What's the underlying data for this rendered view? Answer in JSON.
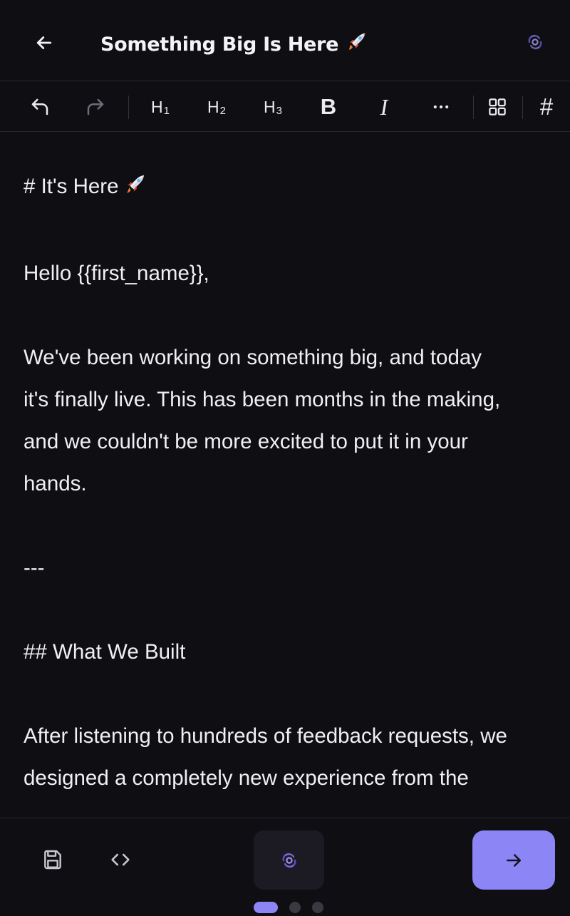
{
  "header": {
    "title": "Something Big Is Here",
    "back_icon": "arrow-left-icon",
    "logo_icon": "swirl-logo-icon"
  },
  "toolbar": {
    "undo_icon": "undo-icon",
    "redo_icon": "redo-icon",
    "h1_label": "H",
    "h1_sub": "1",
    "h2_label": "H",
    "h2_sub": "2",
    "h3_label": "H",
    "h3_sub": "3",
    "bold_label": "B",
    "italic_label": "I",
    "more_icon": "more-horizontal-icon",
    "grid_icon": "grid-icon",
    "hash_label": "#"
  },
  "editor": {
    "heading1": "# It's Here",
    "greeting": "Hello {{first_name}},",
    "para1_lines": [
      "We've been working on something big, and today",
      "it's finally live. This has been months in the making,",
      "and we couldn't be more excited to put it in your",
      "hands."
    ],
    "divider": "---",
    "heading2": "## What We Built",
    "para2_lines": [
      "After listening to hundreds of feedback requests, we",
      "designed a completely new experience from the"
    ]
  },
  "footer": {
    "save_icon": "save-icon",
    "code_icon": "code-icon",
    "center_icon": "swirl-logo-icon",
    "next_icon": "arrow-right-icon",
    "pages": 3,
    "active_page": 1
  },
  "colors": {
    "background": "#0f0e13",
    "accent": "#8b85f5",
    "text": "#f0f0f2",
    "divider": "#26252c"
  }
}
